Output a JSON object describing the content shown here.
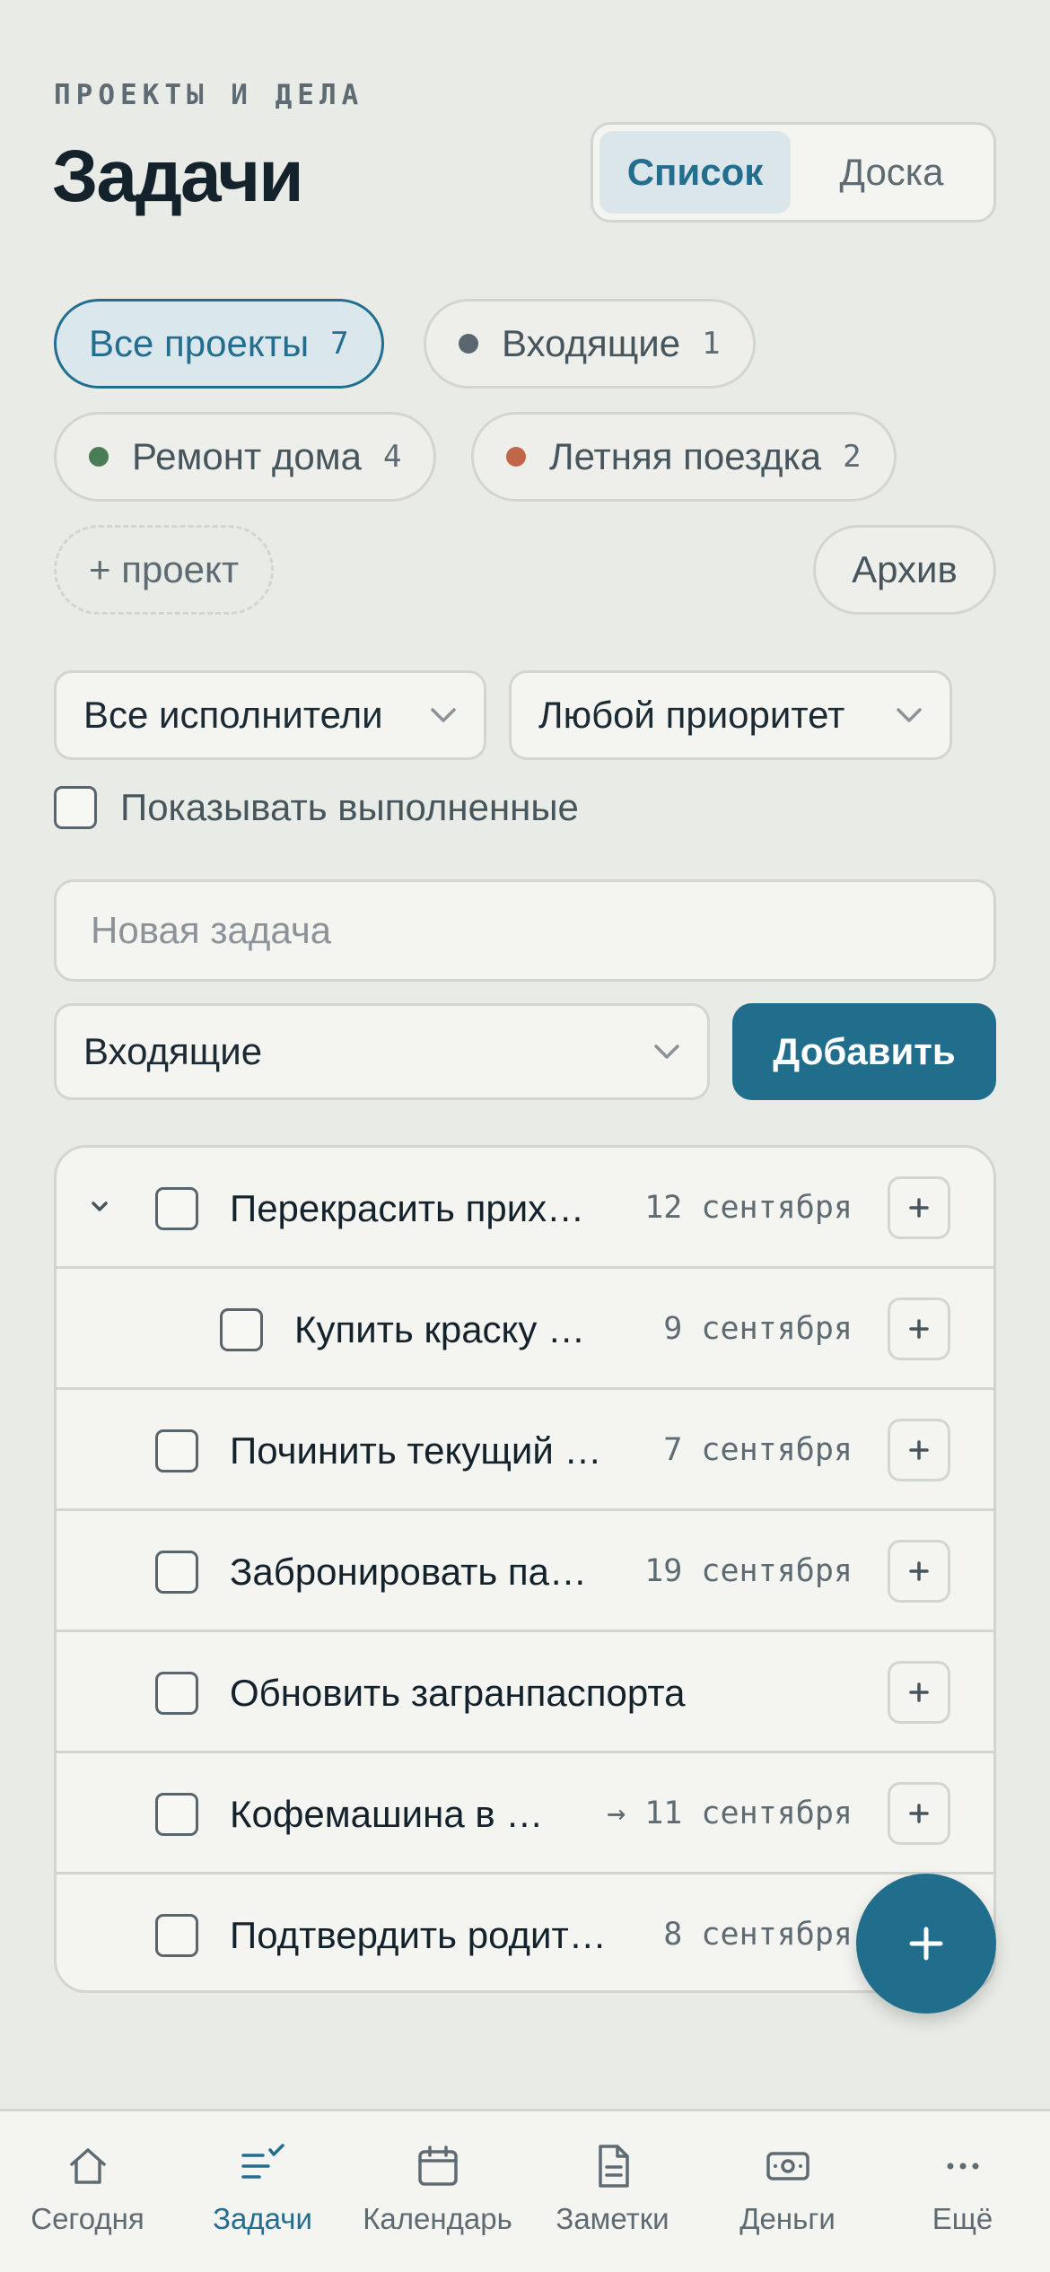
{
  "header": {
    "eyebrow": "ПРОЕКТЫ И ДЕЛА",
    "title": "Задачи",
    "view_tabs": [
      {
        "label": "Список",
        "active": true
      },
      {
        "label": "Доска",
        "active": false
      }
    ]
  },
  "projects": {
    "chips": [
      {
        "label": "Все проекты",
        "count": "7",
        "active": true
      },
      {
        "label": "Входящие",
        "count": "1",
        "dot_color": "#5b6770"
      },
      {
        "label": "Ремонт дома",
        "count": "4",
        "dot_color": "#4a7d55"
      },
      {
        "label": "Летняя поездка",
        "count": "2",
        "dot_color": "#c0674a"
      }
    ],
    "add_label": "+ проект",
    "archive_label": "Архив"
  },
  "filters": {
    "assignee": "Все исполнители",
    "priority": "Любой приоритет",
    "show_done_label": "Показывать выполненные",
    "show_done_checked": false
  },
  "new_task": {
    "placeholder": "Новая задача",
    "value": "",
    "project": "Входящие",
    "add_label": "Добавить"
  },
  "tasks": [
    {
      "title": "Перекрасить прих…",
      "date": "12 сентября",
      "expanded": true,
      "level": 0
    },
    {
      "title": "Купить краску …",
      "date": "9 сентября",
      "level": 1
    },
    {
      "title": "Починить текущий …",
      "date": "7 сентября",
      "level": 0
    },
    {
      "title": "Забронировать па…",
      "date": "19 сентября",
      "level": 0
    },
    {
      "title": "Обновить загранпаспорта",
      "date": "",
      "level": 0
    },
    {
      "title": "Кофемашина в …",
      "date": "→ 11 сентября",
      "level": 0
    },
    {
      "title": "Подтвердить родит…",
      "date": "8 сентября",
      "level": 0
    }
  ],
  "fab_icon": "plus-icon",
  "tabbar": [
    {
      "label": "Сегодня",
      "icon": "home-icon"
    },
    {
      "label": "Задачи",
      "icon": "tasks-icon",
      "active": true
    },
    {
      "label": "Календарь",
      "icon": "calendar-icon"
    },
    {
      "label": "Заметки",
      "icon": "notes-icon"
    },
    {
      "label": "Деньги",
      "icon": "money-icon"
    },
    {
      "label": "Ещё",
      "icon": "more-icon"
    }
  ],
  "colors": {
    "accent": "#216e8c",
    "background": "#e9ebe6",
    "surface": "#f4f4f1"
  }
}
